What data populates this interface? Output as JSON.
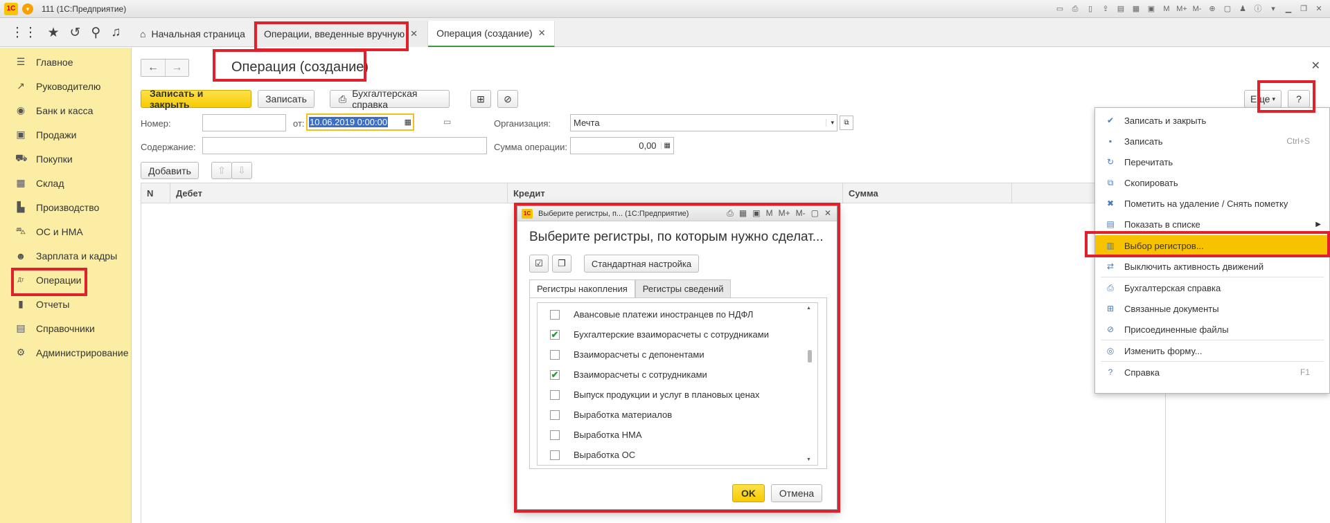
{
  "window": {
    "title": "111 (1С:Предприятие)",
    "logo": "1С"
  },
  "topnav": {
    "icons": [
      "apps-grid-icon",
      "star-icon",
      "history-icon",
      "search-icon",
      "bell-icon"
    ],
    "tabs": [
      {
        "label": "Начальная страница"
      },
      {
        "label": "Операции, введенные вручную"
      },
      {
        "label": "Операция (создание)"
      }
    ]
  },
  "sidebar": {
    "items": [
      {
        "label": "Главное",
        "icon": "☰"
      },
      {
        "label": "Руководителю",
        "icon": "↗"
      },
      {
        "label": "Банк и касса",
        "icon": "◉"
      },
      {
        "label": "Продажи",
        "icon": "▣"
      },
      {
        "label": "Покупки",
        "icon": "⛟"
      },
      {
        "label": "Склад",
        "icon": "▦"
      },
      {
        "label": "Производство",
        "icon": "▙"
      },
      {
        "label": "ОС и НМА",
        "icon": "⛍"
      },
      {
        "label": "Зарплата и кадры",
        "icon": "☻"
      },
      {
        "label": "Операции",
        "icon": "Дт"
      },
      {
        "label": "Отчеты",
        "icon": "▮"
      },
      {
        "label": "Справочники",
        "icon": "▤"
      },
      {
        "label": "Администрирование",
        "icon": "⚙"
      }
    ]
  },
  "form": {
    "title": "Операция (создание)",
    "buttons": {
      "save_close": "Записать и закрыть",
      "save": "Записать",
      "report": "Бухгалтерская справка",
      "more": "Еще",
      "help": "?",
      "add": "Добавить"
    },
    "fields": {
      "number_label": "Номер:",
      "number_value": "",
      "date_label": "от:",
      "date_value": "10.06.2019  0:00:00",
      "org_label": "Организация:",
      "org_value": "Мечта",
      "content_label": "Содержание:",
      "content_value": "",
      "sum_label": "Сумма операции:",
      "sum_value": "0,00"
    },
    "grid_columns": [
      "N",
      "Дебет",
      "Кредит",
      "Сумма"
    ]
  },
  "dropdown": {
    "items": [
      {
        "label": "Записать и закрыть",
        "shortcut": "",
        "icon": "✔"
      },
      {
        "label": "Записать",
        "shortcut": "Ctrl+S",
        "icon": "▪"
      },
      {
        "label": "Перечитать",
        "shortcut": "",
        "icon": "↻"
      },
      {
        "label": "Скопировать",
        "shortcut": "",
        "icon": "⧉"
      },
      {
        "label": "Пометить на удаление / Снять пометку",
        "shortcut": "",
        "icon": "✖"
      },
      {
        "label": "Показать в списке",
        "shortcut": "",
        "icon": "▤"
      },
      {
        "label": "Выбор регистров...",
        "shortcut": "",
        "icon": "▥"
      },
      {
        "label": "Выключить активность движений",
        "shortcut": "",
        "icon": "⇄"
      },
      {
        "label": "Бухгалтерская справка",
        "shortcut": "",
        "icon": "⎙"
      },
      {
        "label": "Связанные документы",
        "shortcut": "",
        "icon": "⊞"
      },
      {
        "label": "Присоединенные файлы",
        "shortcut": "",
        "icon": "⊘"
      },
      {
        "label": "Изменить форму...",
        "shortcut": "",
        "icon": "◎"
      },
      {
        "label": "Справка",
        "shortcut": "F1",
        "icon": "?"
      }
    ]
  },
  "dialog": {
    "titlebar": "Выберите регистры, п...  (1С:Предприятие)",
    "heading": "Выберите регистры, по которым нужно сделат...",
    "std_button": "Стандартная настройка",
    "tabs": [
      "Регистры накопления",
      "Регистры сведений"
    ],
    "rows": [
      {
        "label": "Авансовые платежи иностранцев по НДФЛ",
        "checked": false
      },
      {
        "label": "Бухгалтерские взаиморасчеты с сотрудниками",
        "checked": true
      },
      {
        "label": "Взаиморасчеты с депонентами",
        "checked": false
      },
      {
        "label": "Взаиморасчеты с сотрудниками",
        "checked": true
      },
      {
        "label": "Выпуск продукции и услуг в плановых ценах",
        "checked": false
      },
      {
        "label": "Выработка материалов",
        "checked": false
      },
      {
        "label": "Выработка НМА",
        "checked": false
      },
      {
        "label": "Выработка ОС",
        "checked": false
      }
    ],
    "ok": "OK",
    "cancel": "Отмена"
  }
}
